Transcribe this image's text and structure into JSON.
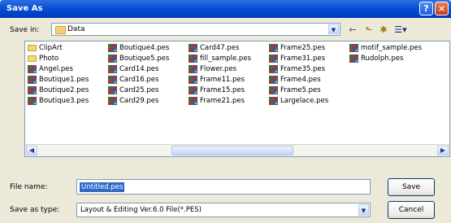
{
  "window": {
    "title": "Save As"
  },
  "titlebar_buttons": {
    "help": "?",
    "close": "×"
  },
  "save_in": {
    "label": "Save in:",
    "value": "Data"
  },
  "toolbar": {
    "back": "←",
    "up": "⬑",
    "new_folder": "✱",
    "views": "☰▾"
  },
  "files": [
    {
      "name": "ClipArt",
      "kind": "folder"
    },
    {
      "name": "Photo",
      "kind": "folder"
    },
    {
      "name": "Angel.pes",
      "kind": "file"
    },
    {
      "name": "Boutique1.pes",
      "kind": "file"
    },
    {
      "name": "Boutique2.pes",
      "kind": "file"
    },
    {
      "name": "Boutique3.pes",
      "kind": "file"
    },
    {
      "name": "Boutique4.pes",
      "kind": "file"
    },
    {
      "name": "Boutique5.pes",
      "kind": "file"
    },
    {
      "name": "Card14.pes",
      "kind": "file"
    },
    {
      "name": "Card16.pes",
      "kind": "file"
    },
    {
      "name": "Card25.pes",
      "kind": "file"
    },
    {
      "name": "Card29.pes",
      "kind": "file"
    },
    {
      "name": "Card47.pes",
      "kind": "file"
    },
    {
      "name": "fill_sample.pes",
      "kind": "file"
    },
    {
      "name": "Flower.pes",
      "kind": "file"
    },
    {
      "name": "Frame11.pes",
      "kind": "file"
    },
    {
      "name": "Frame15.pes",
      "kind": "file"
    },
    {
      "name": "Frame21.pes",
      "kind": "file"
    },
    {
      "name": "Frame25.pes",
      "kind": "file"
    },
    {
      "name": "Frame31.pes",
      "kind": "file"
    },
    {
      "name": "Frame35.pes",
      "kind": "file"
    },
    {
      "name": "Frame4.pes",
      "kind": "file"
    },
    {
      "name": "Frame5.pes",
      "kind": "file"
    },
    {
      "name": "Largelace.pes",
      "kind": "file"
    },
    {
      "name": "motif_sample.pes",
      "kind": "file"
    },
    {
      "name": "Rudolph.pes",
      "kind": "file"
    }
  ],
  "file_name": {
    "label": "File name:",
    "value": "Untitled.pes"
  },
  "save_as_type": {
    "label": "Save as type:",
    "value": "Layout & Editing Ver.6.0 File(*.PES)"
  },
  "buttons": {
    "save": "Save",
    "cancel": "Cancel"
  },
  "colors": {
    "title_bar": "#0a52d6",
    "selection": "#316ac5",
    "dialog_bg": "#ece9d8"
  }
}
